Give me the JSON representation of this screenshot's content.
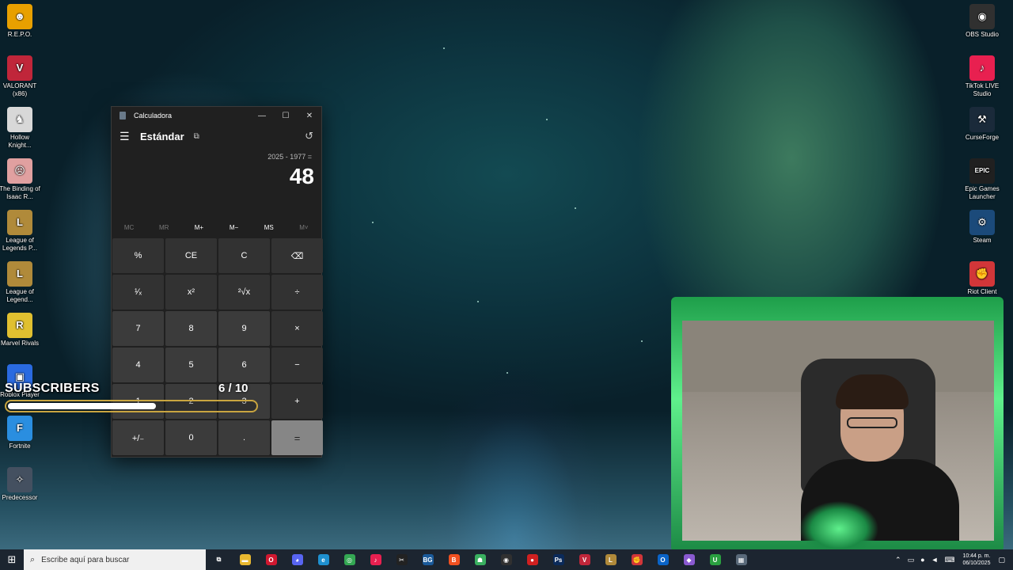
{
  "desktop": {
    "left_icons": [
      {
        "label": "R.E.P.O.",
        "icon": "repo-icon",
        "color": "#e8a000",
        "glyph": "☻"
      },
      {
        "label": "VALORANT (x86)",
        "icon": "valorant-icon",
        "color": "#c0263a",
        "glyph": "V"
      },
      {
        "label": "Hollow Knight...",
        "icon": "hollow-knight-icon",
        "color": "#d8d8d8",
        "glyph": "♞"
      },
      {
        "label": "The Binding of Isaac R...",
        "icon": "isaac-icon",
        "color": "#e0a0a0",
        "glyph": "☹"
      },
      {
        "label": "League of Legends P...",
        "icon": "league-icon",
        "color": "#b08a3a",
        "glyph": "L"
      },
      {
        "label": "League of Legend...",
        "icon": "league-icon",
        "color": "#b08a3a",
        "glyph": "L"
      },
      {
        "label": "Marvel Rivals",
        "icon": "marvel-rivals-icon",
        "color": "#e0c030",
        "glyph": "R"
      },
      {
        "label": "Roblox Player",
        "icon": "roblox-icon",
        "color": "#2a6ae0",
        "glyph": "▣"
      },
      {
        "label": "Fortnite",
        "icon": "fortnite-icon",
        "color": "#2a8ee0",
        "glyph": "F"
      },
      {
        "label": "Predecessor",
        "icon": "predecessor-icon",
        "color": "#445060",
        "glyph": "✧"
      }
    ],
    "right_icons": [
      {
        "label": "OBS Studio",
        "icon": "obs-icon",
        "color": "#303030",
        "glyph": "◉"
      },
      {
        "label": "TikTok LIVE Studio",
        "icon": "tiktok-icon",
        "color": "#e82050",
        "glyph": "♪"
      },
      {
        "label": "CurseForge",
        "icon": "curseforge-icon",
        "color": "#1a2a3a",
        "glyph": "⚒"
      },
      {
        "label": "Epic Games Launcher",
        "icon": "epic-games-icon",
        "color": "#202020",
        "glyph": "EPIC"
      },
      {
        "label": "Steam",
        "icon": "steam-icon",
        "color": "#1b4a7a",
        "glyph": "⚙"
      },
      {
        "label": "Riot Client",
        "icon": "riot-icon",
        "color": "#d13639",
        "glyph": "✊"
      }
    ]
  },
  "calculator": {
    "title": "Calculadora",
    "mode": "Estándar",
    "expression": "2025 - 1977 =",
    "result": "48",
    "memory": [
      "MC",
      "MR",
      "M+",
      "M−",
      "MS",
      "M˅"
    ],
    "memory_disabled": [
      true,
      true,
      false,
      false,
      false,
      true
    ],
    "keys": [
      [
        "%",
        "CE",
        "C",
        "⌫"
      ],
      [
        "¹⁄ₓ",
        "x²",
        "²√x",
        "÷"
      ],
      [
        "7",
        "8",
        "9",
        "×"
      ],
      [
        "4",
        "5",
        "6",
        "−"
      ],
      [
        "1",
        "2",
        "3",
        "+"
      ],
      [
        "+/₋",
        "0",
        ".",
        "="
      ]
    ]
  },
  "overlay": {
    "subscribers_label": "SUBSCRIBERS",
    "count": "6  / 10",
    "progress": 0.6
  },
  "taskbar": {
    "search_placeholder": "Escribe aquí para buscar",
    "time": "10:44 p. m.",
    "date": "06/10/2025",
    "apps": [
      {
        "name": "task-view",
        "glyph": "⧉",
        "color": "#1c2530"
      },
      {
        "name": "file-explorer",
        "glyph": "▬",
        "color": "#e8b830"
      },
      {
        "name": "opera",
        "glyph": "O",
        "color": "#d01830"
      },
      {
        "name": "discord",
        "glyph": "◕",
        "color": "#5865f2"
      },
      {
        "name": "edge",
        "glyph": "e",
        "color": "#1e90d0"
      },
      {
        "name": "chrome",
        "glyph": "◎",
        "color": "#34a853"
      },
      {
        "name": "tiktok",
        "glyph": "♪",
        "color": "#e82050"
      },
      {
        "name": "capcut",
        "glyph": "✂",
        "color": "#222222"
      },
      {
        "name": "bg",
        "glyph": "BG",
        "color": "#1a5a9a"
      },
      {
        "name": "brave",
        "glyph": "B",
        "color": "#f05020"
      },
      {
        "name": "android",
        "glyph": "☗",
        "color": "#3ab060"
      },
      {
        "name": "obs",
        "glyph": "◉",
        "color": "#303030"
      },
      {
        "name": "record",
        "glyph": "●",
        "color": "#d02020"
      },
      {
        "name": "photoshop",
        "glyph": "Ps",
        "color": "#0a2a5a"
      },
      {
        "name": "valorant",
        "glyph": "V",
        "color": "#c0263a"
      },
      {
        "name": "league",
        "glyph": "L",
        "color": "#b08a3a"
      },
      {
        "name": "riot",
        "glyph": "✊",
        "color": "#d13639"
      },
      {
        "name": "outlook",
        "glyph": "O",
        "color": "#0a64c8"
      },
      {
        "name": "copilot",
        "glyph": "◆",
        "color": "#8a5ad0"
      },
      {
        "name": "upwork",
        "glyph": "U",
        "color": "#2aa040"
      },
      {
        "name": "calculator",
        "glyph": "▦",
        "color": "#5a6a7a"
      }
    ]
  }
}
